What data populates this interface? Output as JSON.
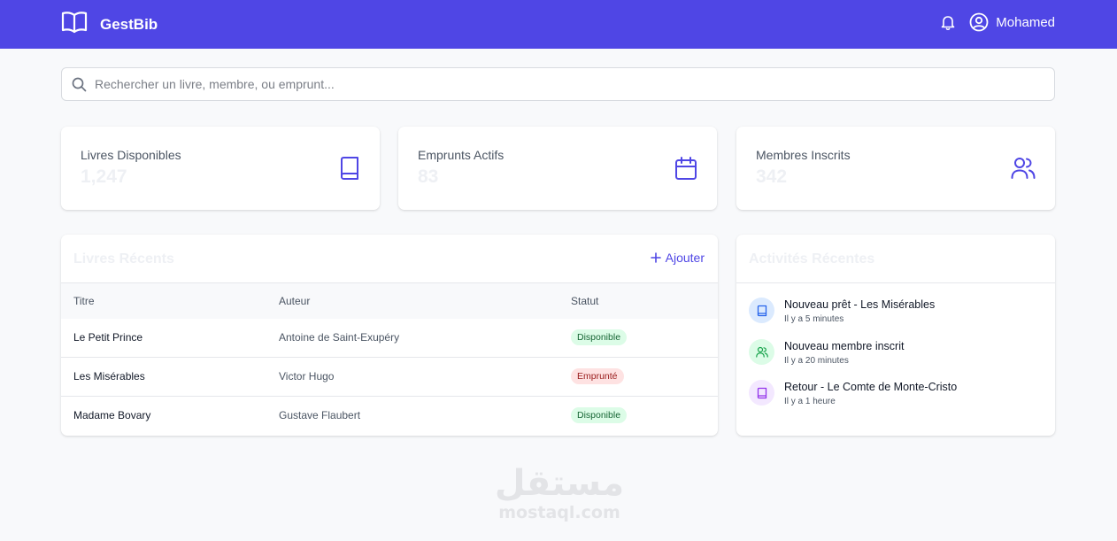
{
  "header": {
    "brand": "GestBib",
    "brand_icon": "book-open-icon",
    "notification_icon": "bell-icon",
    "user_icon": "user-circle-icon",
    "user_name": "Mohamed",
    "background_color": "#4f46e5"
  },
  "search": {
    "placeholder": "Rechercher un livre, membre, ou emprunt...",
    "value": "",
    "icon": "search-icon"
  },
  "stats": [
    {
      "label": "Livres Disponibles",
      "value": "1,247",
      "icon": "book-icon"
    },
    {
      "label": "Emprunts Actifs",
      "value": "83",
      "icon": "calendar-icon"
    },
    {
      "label": "Membres Inscrits",
      "value": "342",
      "icon": "users-icon"
    }
  ],
  "recent_books": {
    "title": "Livres Récents",
    "add_label": "Ajouter",
    "columns": [
      "Titre",
      "Auteur",
      "Statut"
    ],
    "rows": [
      {
        "title": "Le Petit Prince",
        "author": "Antoine de Saint-Exupéry",
        "status": "Disponible",
        "status_kind": "available"
      },
      {
        "title": "Les Misérables",
        "author": "Victor Hugo",
        "status": "Emprunté",
        "status_kind": "borrowed"
      },
      {
        "title": "Madame Bovary",
        "author": "Gustave Flaubert",
        "status": "Disponible",
        "status_kind": "available"
      }
    ]
  },
  "recent_activities": {
    "title": "Activités Récentes",
    "items": [
      {
        "title": "Nouveau prêt - Les Misérables",
        "time": "Il y a 5 minutes",
        "icon": "book-icon",
        "color": "#2563eb",
        "background": "#dbeafe"
      },
      {
        "title": "Nouveau membre inscrit",
        "time": "Il y a 20 minutes",
        "icon": "users-icon",
        "color": "#16a34a",
        "background": "#dcfce7"
      },
      {
        "title": "Retour - Le Comte de Monte-Cristo",
        "time": "Il y a 1 heure",
        "icon": "book-icon",
        "color": "#9333ea",
        "background": "#f3e8ff"
      }
    ]
  },
  "watermark": {
    "arabic": "مستقل",
    "latin": "mostaql.com"
  },
  "colors": {
    "accent": "#4f46e5",
    "available": "#dcfce7",
    "borrowed": "#fee2e2"
  }
}
